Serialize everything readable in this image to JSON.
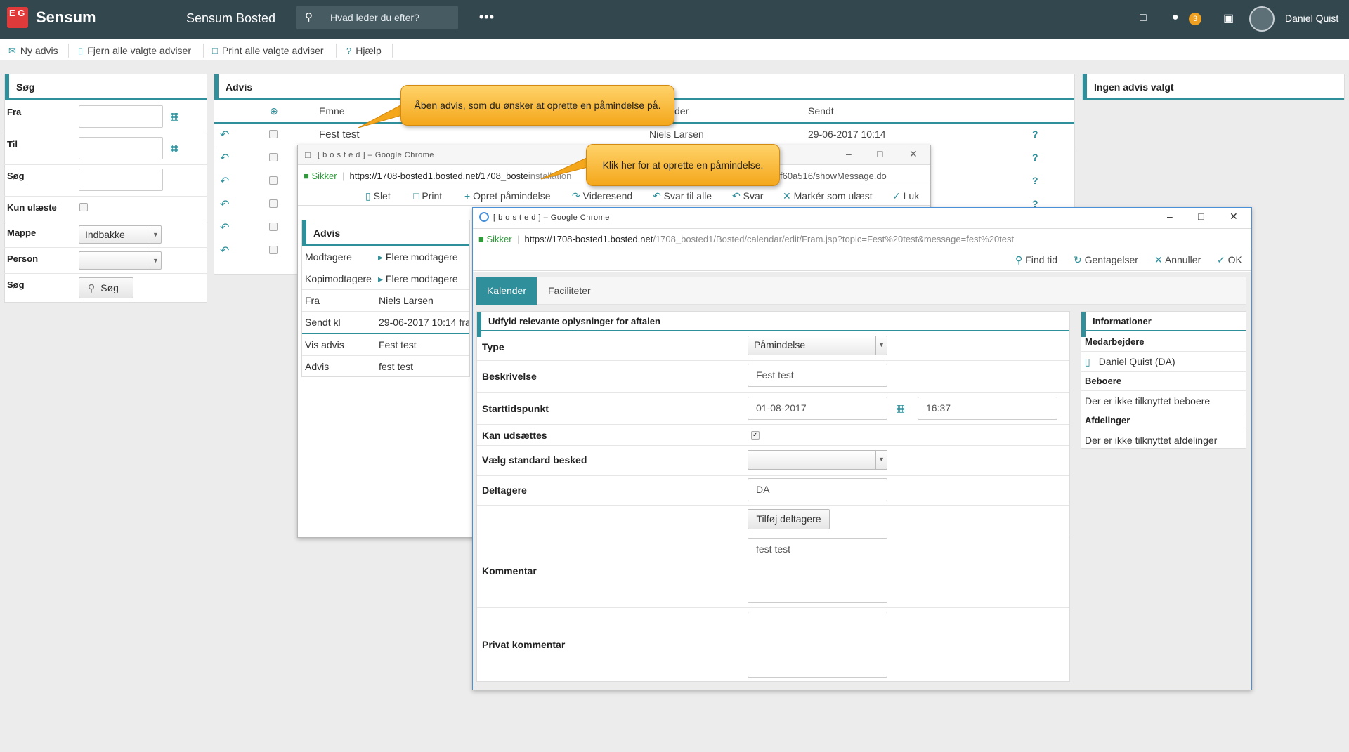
{
  "app": {
    "logo_mark": "E G",
    "logo_text": "Sensum",
    "title": "Sensum Bosted",
    "search_placeholder": "Hvad leder du efter?",
    "notification_count": "3",
    "user_name": "Daniel Quist"
  },
  "toolbar": {
    "new_advis": "Ny advis",
    "remove_all": "Fjern alle valgte adviser",
    "print_all": "Print alle valgte adviser",
    "help": "Hjælp"
  },
  "search_panel": {
    "title": "Søg",
    "from_label": "Fra",
    "to_label": "Til",
    "search_label": "Søg",
    "unread_label": "Kun ulæste",
    "folder_label": "Mappe",
    "folder_value": "Indbakke",
    "person_label": "Person",
    "person_value": "",
    "search_button_label": "Søg",
    "search_button": "Søg"
  },
  "advis_panel": {
    "title": "Advis",
    "col_subject": "Emne",
    "col_sender": "der",
    "col_sent": "Sendt",
    "rows": [
      {
        "subject": "Fest test",
        "sender": "Niels Larsen",
        "sent": "29-06-2017 10:14",
        "help": "?"
      },
      {
        "help": "?"
      },
      {
        "help": "?"
      },
      {
        "help": "?"
      }
    ]
  },
  "right_panel": {
    "title": "Ingen advis valgt"
  },
  "callouts": {
    "first": "Åben advis, som du ønsker at oprette en påmindelse på.",
    "second": "Klik her for at oprette en påmindelse."
  },
  "msg_window": {
    "title": "[ b o s t e d ] – Google Chrome",
    "secure": "Sikker",
    "url_start": "https://1708-bosted1.bosted.net/1708_boste",
    "url_mid": "installation",
    "url_end": "f60a516/showMessage.do",
    "actions": {
      "delete": "Slet",
      "print": "Print",
      "create_reminder": "Opret påmindelse",
      "forward": "Videresend",
      "reply_all": "Svar til alle",
      "reply": "Svar",
      "mark_unread": "Markér som ulæst",
      "close": "Luk"
    },
    "panel_title": "Advis",
    "fields": [
      {
        "label": "Modtagere",
        "value": "Flere modtagere"
      },
      {
        "label": "Kopimodtagere",
        "value": "Flere modtagere"
      },
      {
        "label": "Fra",
        "value": "Niels Larsen"
      },
      {
        "label": "Sendt kl",
        "value": "29-06-2017 10:14 fra"
      },
      {
        "label": "Vis advis",
        "value": "Fest test"
      },
      {
        "label": "Advis",
        "value": "fest test"
      }
    ]
  },
  "cal_window": {
    "title": "[ b o s t e d ] – Google Chrome",
    "secure": "Sikker",
    "url_host": "https://1708-bosted1.bosted.net",
    "url_path": "/1708_bosted1/Bosted/calendar/edit/Fram.jsp?topic=Fest%20test&message=fest%20test",
    "actions": {
      "find_time": "Find tid",
      "repeats": "Gentagelser",
      "cancel": "Annuller",
      "ok": "OK"
    },
    "tabs": [
      "Kalender",
      "Faciliteter"
    ],
    "form_title": "Udfyld relevante oplysninger for aftalen",
    "type_label": "Type",
    "type_value": "Påmindelse",
    "description_label": "Beskrivelse",
    "description_value": "Fest test",
    "start_label": "Starttidspunkt",
    "start_date": "01-08-2017",
    "start_time": "16:37",
    "postpone_label": "Kan udsættes",
    "standard_msg_label": "Vælg standard besked",
    "standard_msg_value": "",
    "participants_label": "Deltagere",
    "participants_value": "DA",
    "add_participants": "Tilføj deltagere",
    "comment_label": "Kommentar",
    "comment_value": "fest test",
    "private_comment_label": "Privat kommentar",
    "private_comment_value": "",
    "info_title": "Informationer",
    "staff_label": "Medarbejdere",
    "staff_value": "Daniel Quist (DA)",
    "residents_label": "Beboere",
    "residents_value": "Der er ikke tilknyttet beboere",
    "departments_label": "Afdelinger",
    "departments_value": "Der er ikke tilknyttet afdelinger"
  },
  "colors": {
    "topbar": "#33474f",
    "accent": "#2f8f9a",
    "callout": "#f4a71b",
    "badge": "#f0a020"
  }
}
